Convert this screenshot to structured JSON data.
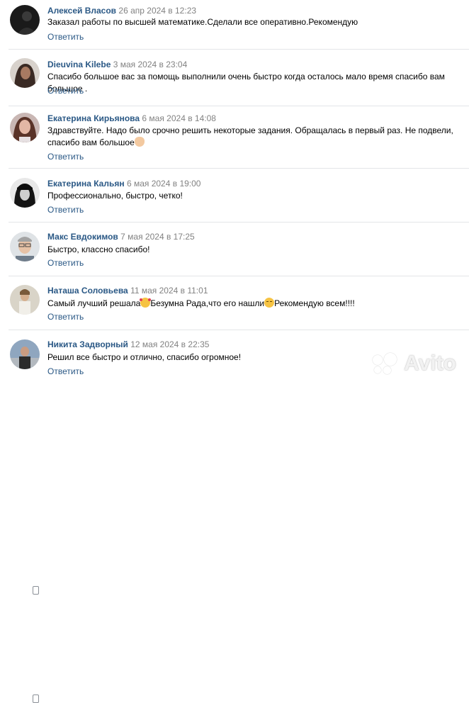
{
  "reply_label": "Ответить",
  "comments": [
    {
      "author": "Алексей Власов",
      "date": "26 апр 2024 в 12:23",
      "text": "Заказал работы по высшей математике.Сделали все оперативно.Рекомендую"
    },
    {
      "author": "Dieuvina Kilebe",
      "date": "3 мая 2024 в 23:04",
      "text": "Спасибо большое вас за помощь выполнили очень быстро когда осталось мало время спасибо вам большое ."
    },
    {
      "author": "Екатерина Кирьянова",
      "date": "6 мая 2024 в 14:08",
      "text": "Здравствуйте. Надо было срочно решить некоторые задания. Обращалась в первый раз. Не подвели, спасибо вам большое"
    },
    {
      "author": "Екатерина Кальян",
      "date": "6 мая 2024 в 19:00",
      "text": "Профессионально, быстро, четко!"
    },
    {
      "author": "Макс Евдокимов",
      "date": "7 мая 2024 в 17:25",
      "text": "Быстро, классно спасибо!"
    },
    {
      "author": "Наташа Соловьева",
      "date": "11 мая 2024 в 11:01",
      "text_part1": "Самый лучший решала",
      "text_part2": "Безумна Рада,что его нашли",
      "text_part3": "Рекомендую всем!!!!"
    },
    {
      "author": "Никита Задворный",
      "date": "12 мая 2024 в 22:35",
      "text": "Решил все быстро и отлично, спасибо огромное!"
    }
  ],
  "emoji": [
    "smiling-face-with-hearts-emoji",
    "grimacing-face-emoji",
    "folded-hands-emoji"
  ],
  "watermark": "Avito",
  "colors": {
    "author": "#2a5885",
    "date": "#828282",
    "reply": "#2a5885",
    "divider": "#e3e5e8"
  }
}
